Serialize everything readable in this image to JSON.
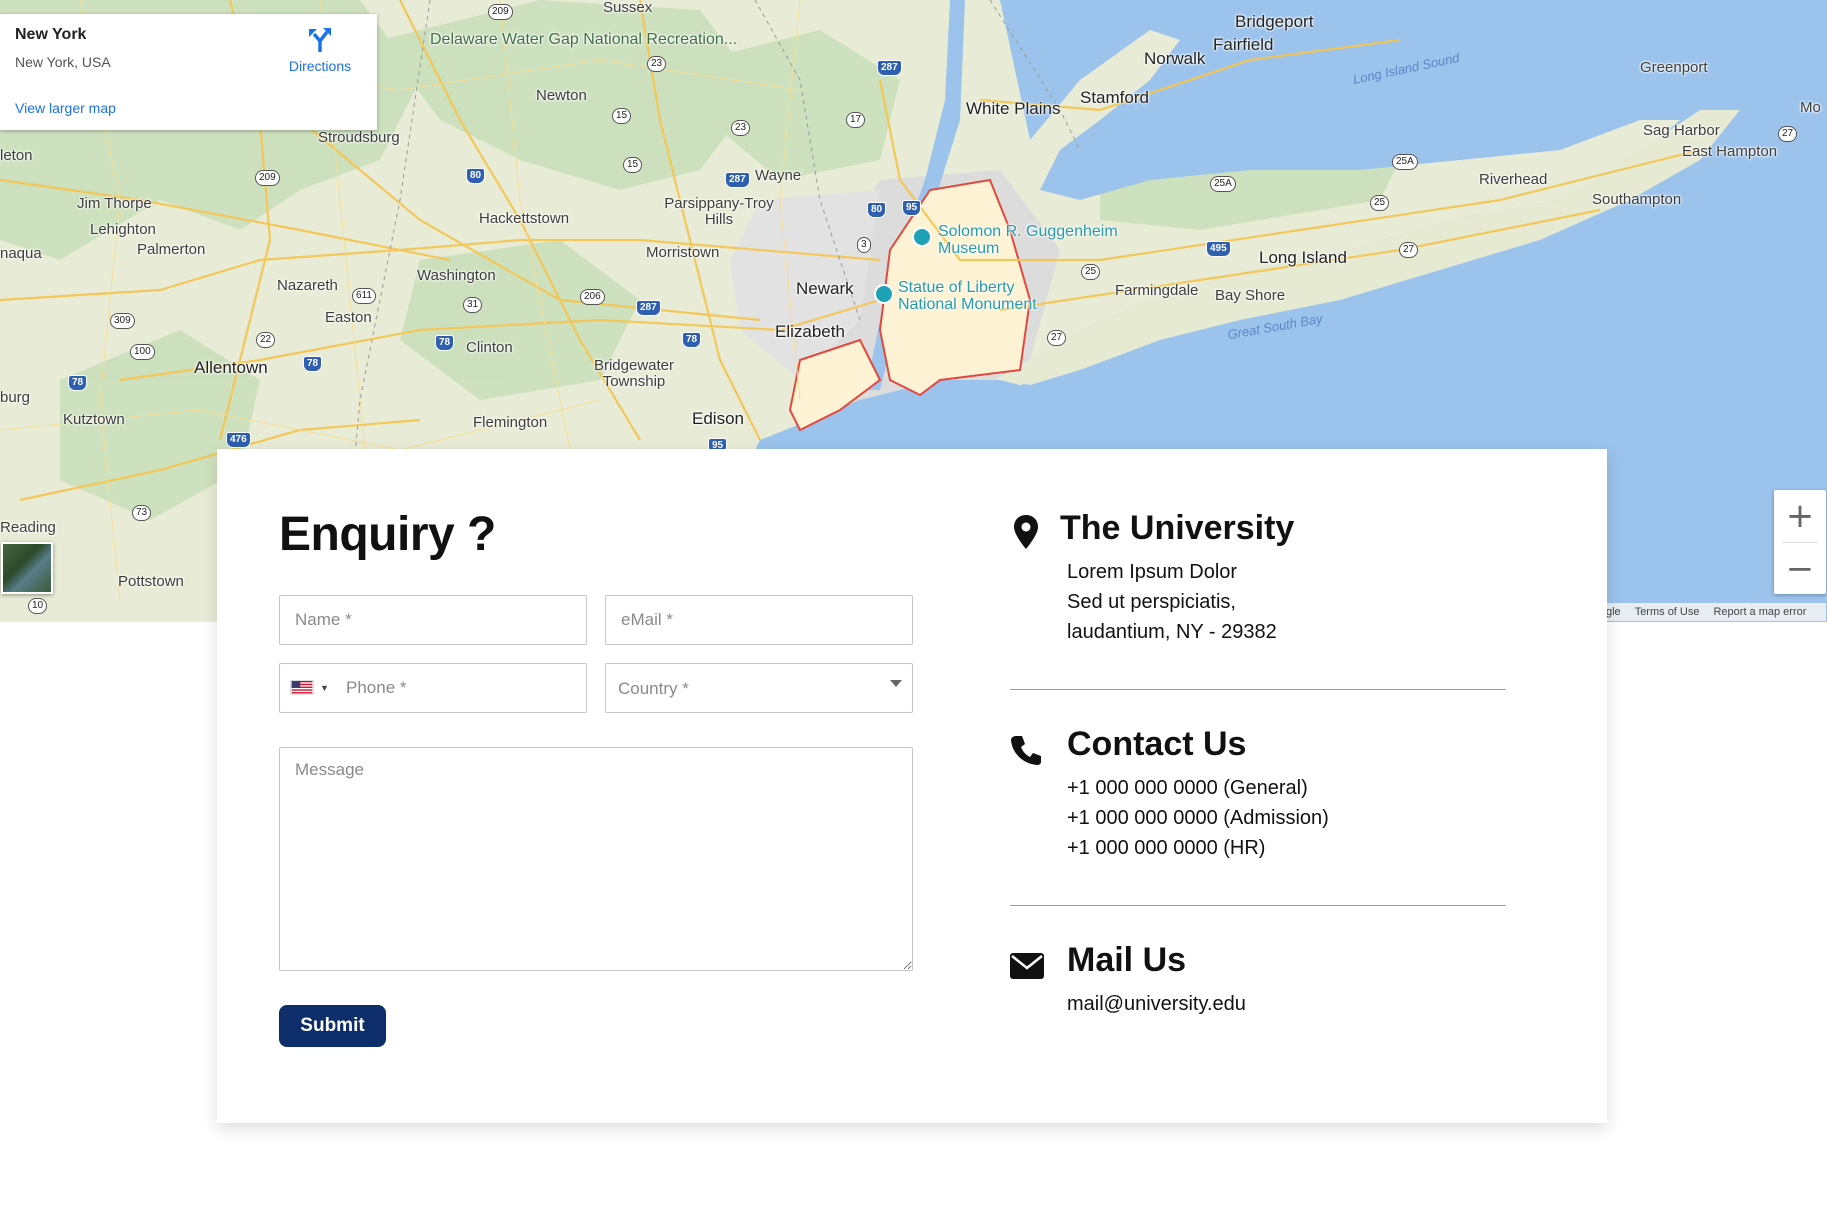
{
  "map": {
    "place_title": "New York",
    "place_sub": "New York, USA",
    "larger_map_link": "View larger map",
    "directions_label": "Directions",
    "zoom_in": "+",
    "zoom_out": "−",
    "footer": [
      "gle",
      "Terms of Use",
      "Report a map error"
    ],
    "labels": [
      {
        "text": "Delaware Water Gap National Recreation...",
        "kind": "green"
      },
      {
        "text": "Stroudsburg"
      },
      {
        "text": "Newton"
      },
      {
        "text": "Jim Thorpe"
      },
      {
        "text": "Lehighton"
      },
      {
        "text": "Palmerton"
      },
      {
        "text": "Nazareth"
      },
      {
        "text": "Easton"
      },
      {
        "text": "Allentown",
        "kind": "big"
      },
      {
        "text": "Kutztown"
      },
      {
        "text": "Reading"
      },
      {
        "text": "Pottstown"
      },
      {
        "text": "Hackettstown"
      },
      {
        "text": "Washington"
      },
      {
        "text": "Clinton"
      },
      {
        "text": "Flemington"
      },
      {
        "text": "Bridgewater Township"
      },
      {
        "text": "Morristown"
      },
      {
        "text": "Parsippany-Troy Hills"
      },
      {
        "text": "Wayne"
      },
      {
        "text": "Newark",
        "kind": "big"
      },
      {
        "text": "Elizabeth",
        "kind": "big"
      },
      {
        "text": "Edison",
        "kind": "big"
      },
      {
        "text": "White Plains",
        "kind": "big"
      },
      {
        "text": "Stamford",
        "kind": "big"
      },
      {
        "text": "Norwalk",
        "kind": "big"
      },
      {
        "text": "Bridgeport",
        "kind": "big"
      },
      {
        "text": "Fairfield",
        "kind": "big"
      },
      {
        "text": "Long Island Sound",
        "kind": "water"
      },
      {
        "text": "Greenport"
      },
      {
        "text": "Sag Harbor"
      },
      {
        "text": "East Hampton"
      },
      {
        "text": "Riverhead"
      },
      {
        "text": "Southampton"
      },
      {
        "text": "Long Island",
        "kind": "big"
      },
      {
        "text": "Farmingdale"
      },
      {
        "text": "Bay Shore"
      },
      {
        "text": "Great South Bay",
        "kind": "water"
      },
      {
        "text": "Solomon R. Guggenheim Museum",
        "kind": "teal"
      },
      {
        "text": "Statue of Liberty National Monument",
        "kind": "teal"
      },
      {
        "text": "Sussex"
      },
      {
        "text": "leton"
      },
      {
        "text": "naqua"
      },
      {
        "text": "burg"
      },
      {
        "text": "Mo"
      }
    ],
    "shields": [
      "209",
      "23",
      "287",
      "15",
      "23",
      "17",
      "15",
      "209",
      "80",
      "287",
      "80",
      "95",
      "3",
      "611",
      "31",
      "206",
      "287",
      "309",
      "100",
      "22",
      "78",
      "78",
      "78",
      "78",
      "476",
      "73",
      "10",
      "95",
      "25A",
      "25A",
      "25",
      "495",
      "27",
      "25",
      "27",
      "27"
    ]
  },
  "form": {
    "title": "Enquiry ?",
    "name_placeholder": "Name *",
    "email_placeholder": "eMail *",
    "phone_placeholder": "Phone *",
    "country_placeholder": "Country *",
    "message_placeholder": "Message",
    "submit_label": "Submit"
  },
  "contact": {
    "university": {
      "title": "The University",
      "lines": [
        "Lorem Ipsum Dolor",
        "Sed ut perspiciatis,",
        "laudantium, NY - 29382"
      ]
    },
    "phone": {
      "title": "Contact Us",
      "lines": [
        "+1 000 000 0000 (General)",
        "+1 000 000 0000 (Admission)",
        "+1 000 000 0000 (HR)"
      ]
    },
    "mail": {
      "title": "Mail Us",
      "lines": [
        "mail@university.edu"
      ]
    }
  },
  "colors": {
    "submit_bg": "#0d2e6b",
    "link": "#1a73e8",
    "water": "#99c2ee",
    "land": "#e9ecd9"
  }
}
